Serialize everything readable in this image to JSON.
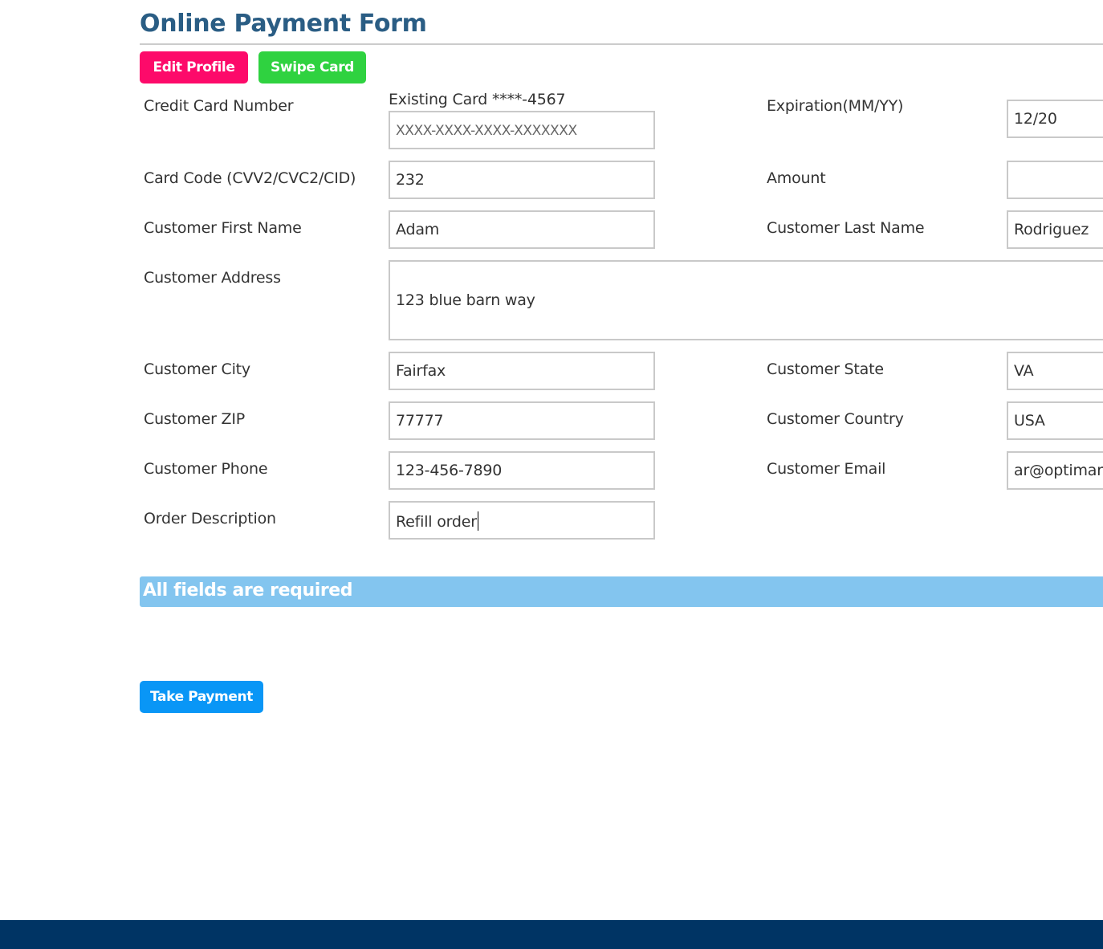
{
  "form": {
    "title": "Online Payment Form",
    "buttons": {
      "edit_profile": "Edit Profile",
      "swipe_card": "Swipe Card",
      "take_payment": "Take Payment"
    },
    "credit_card": {
      "label": "Credit Card Number",
      "existing_hint": "Existing Card ****-4567",
      "value": "",
      "placeholder": "XXXX-XXXX-XXXX-XXXXXXX"
    },
    "expiration": {
      "label": "Expiration(MM/YY)",
      "value": "12/20"
    },
    "card_code": {
      "label": "Card Code (CVV2/CVC2/CID)",
      "value": "232"
    },
    "amount": {
      "label": "Amount",
      "value": ""
    },
    "first_name": {
      "label": "Customer First Name",
      "value": "Adam"
    },
    "last_name": {
      "label": "Customer Last Name",
      "value": "Rodriguez"
    },
    "address": {
      "label": "Customer Address",
      "value": "123 blue barn way"
    },
    "city": {
      "label": "Customer City",
      "value": "Fairfax"
    },
    "state": {
      "label": "Customer State",
      "value": "VA"
    },
    "zip": {
      "label": "Customer ZIP",
      "value": "77777"
    },
    "country": {
      "label": "Customer Country",
      "value": "USA"
    },
    "phone": {
      "label": "Customer Phone",
      "value": "123-456-7890"
    },
    "email": {
      "label": "Customer Email",
      "value": "ar@optimar"
    },
    "order_description": {
      "label": "Order Description",
      "value": "Refill order"
    },
    "notice": "All fields are required"
  },
  "colors": {
    "title": "#2a5d84",
    "edit_profile": "#fd0a6a",
    "swipe_card": "#2fd240",
    "take_payment": "#0996f6",
    "notice_bar": "#83c5ef",
    "footer": "#003464"
  }
}
